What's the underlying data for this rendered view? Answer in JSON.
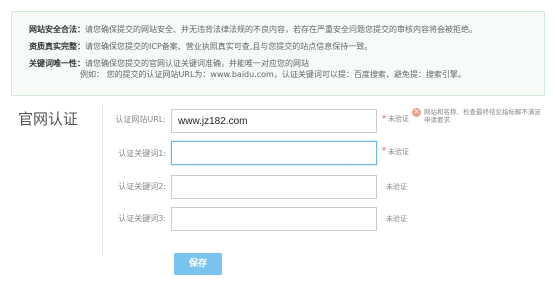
{
  "notice": {
    "rows": [
      {
        "key": "网站安全合法：",
        "value": "请您确保提交的网站安全、并无违背法律法规的不良内容，若存在严重安全问题您提交的审核内容将会被拒绝。"
      },
      {
        "key": "资质真实完整：",
        "value": "请您确保您提交的ICP备案、营业执照真实可查,且与您提交的站点信息保持一致。"
      },
      {
        "key": "关键词唯一性：",
        "value": "请您确保您提交的官网认证关键词准确，并能唯一对应您的网站"
      }
    ],
    "example": "例如：   您的提交的认证网站URL为：www.baidu.com，认证关键词可以提：百度搜索，避免提：搜索引擎。"
  },
  "form": {
    "section_title": "官网认证",
    "fields": [
      {
        "label": "认证网站URL:",
        "value": "www.jz182.com",
        "placeholder": "",
        "status": "未验证",
        "required": true
      },
      {
        "label": "认证关键词1:",
        "value": "",
        "placeholder": "",
        "status": "未验证",
        "required": true
      },
      {
        "label": "认证关键词2:",
        "value": "",
        "placeholder": "",
        "status": "未验证",
        "required": false
      },
      {
        "label": "认证关键词3:",
        "value": "",
        "placeholder": "",
        "status": "未验证",
        "required": false
      }
    ],
    "url_hint": "网站和名称、检查最终结论指标解不满足申请要求",
    "required_mark": "*",
    "warn_icon": "close-circle-icon",
    "save_label": "保存"
  },
  "colors": {
    "notice_bg": "#f7fbf8",
    "notice_border": "#d3ead7",
    "required": "#e24a4a",
    "button": "#79c4ef",
    "focus_border": "#6fb8ea"
  }
}
